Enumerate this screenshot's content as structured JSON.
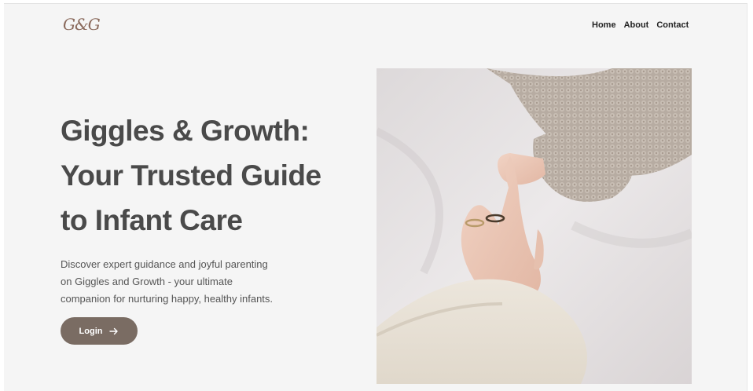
{
  "brand": {
    "logo_text": "G&G"
  },
  "nav": {
    "items": [
      "Home",
      "About",
      "Contact"
    ]
  },
  "hero": {
    "title_lines": [
      "Giggles & Growth:",
      "Your Trusted Guide",
      "to Infant Care"
    ],
    "description_lines": [
      "Discover expert guidance and joyful parenting",
      "on Giggles and Growth - your ultimate",
      "companion for nurturing happy, healthy infants."
    ],
    "login_label": "Login"
  },
  "image": {
    "subject": "adult hand holding infant hand"
  },
  "colors": {
    "accent": "#7a6c63",
    "logo": "#8a6a5c",
    "title": "#4a4a4a",
    "background": "#f5f5f5"
  }
}
